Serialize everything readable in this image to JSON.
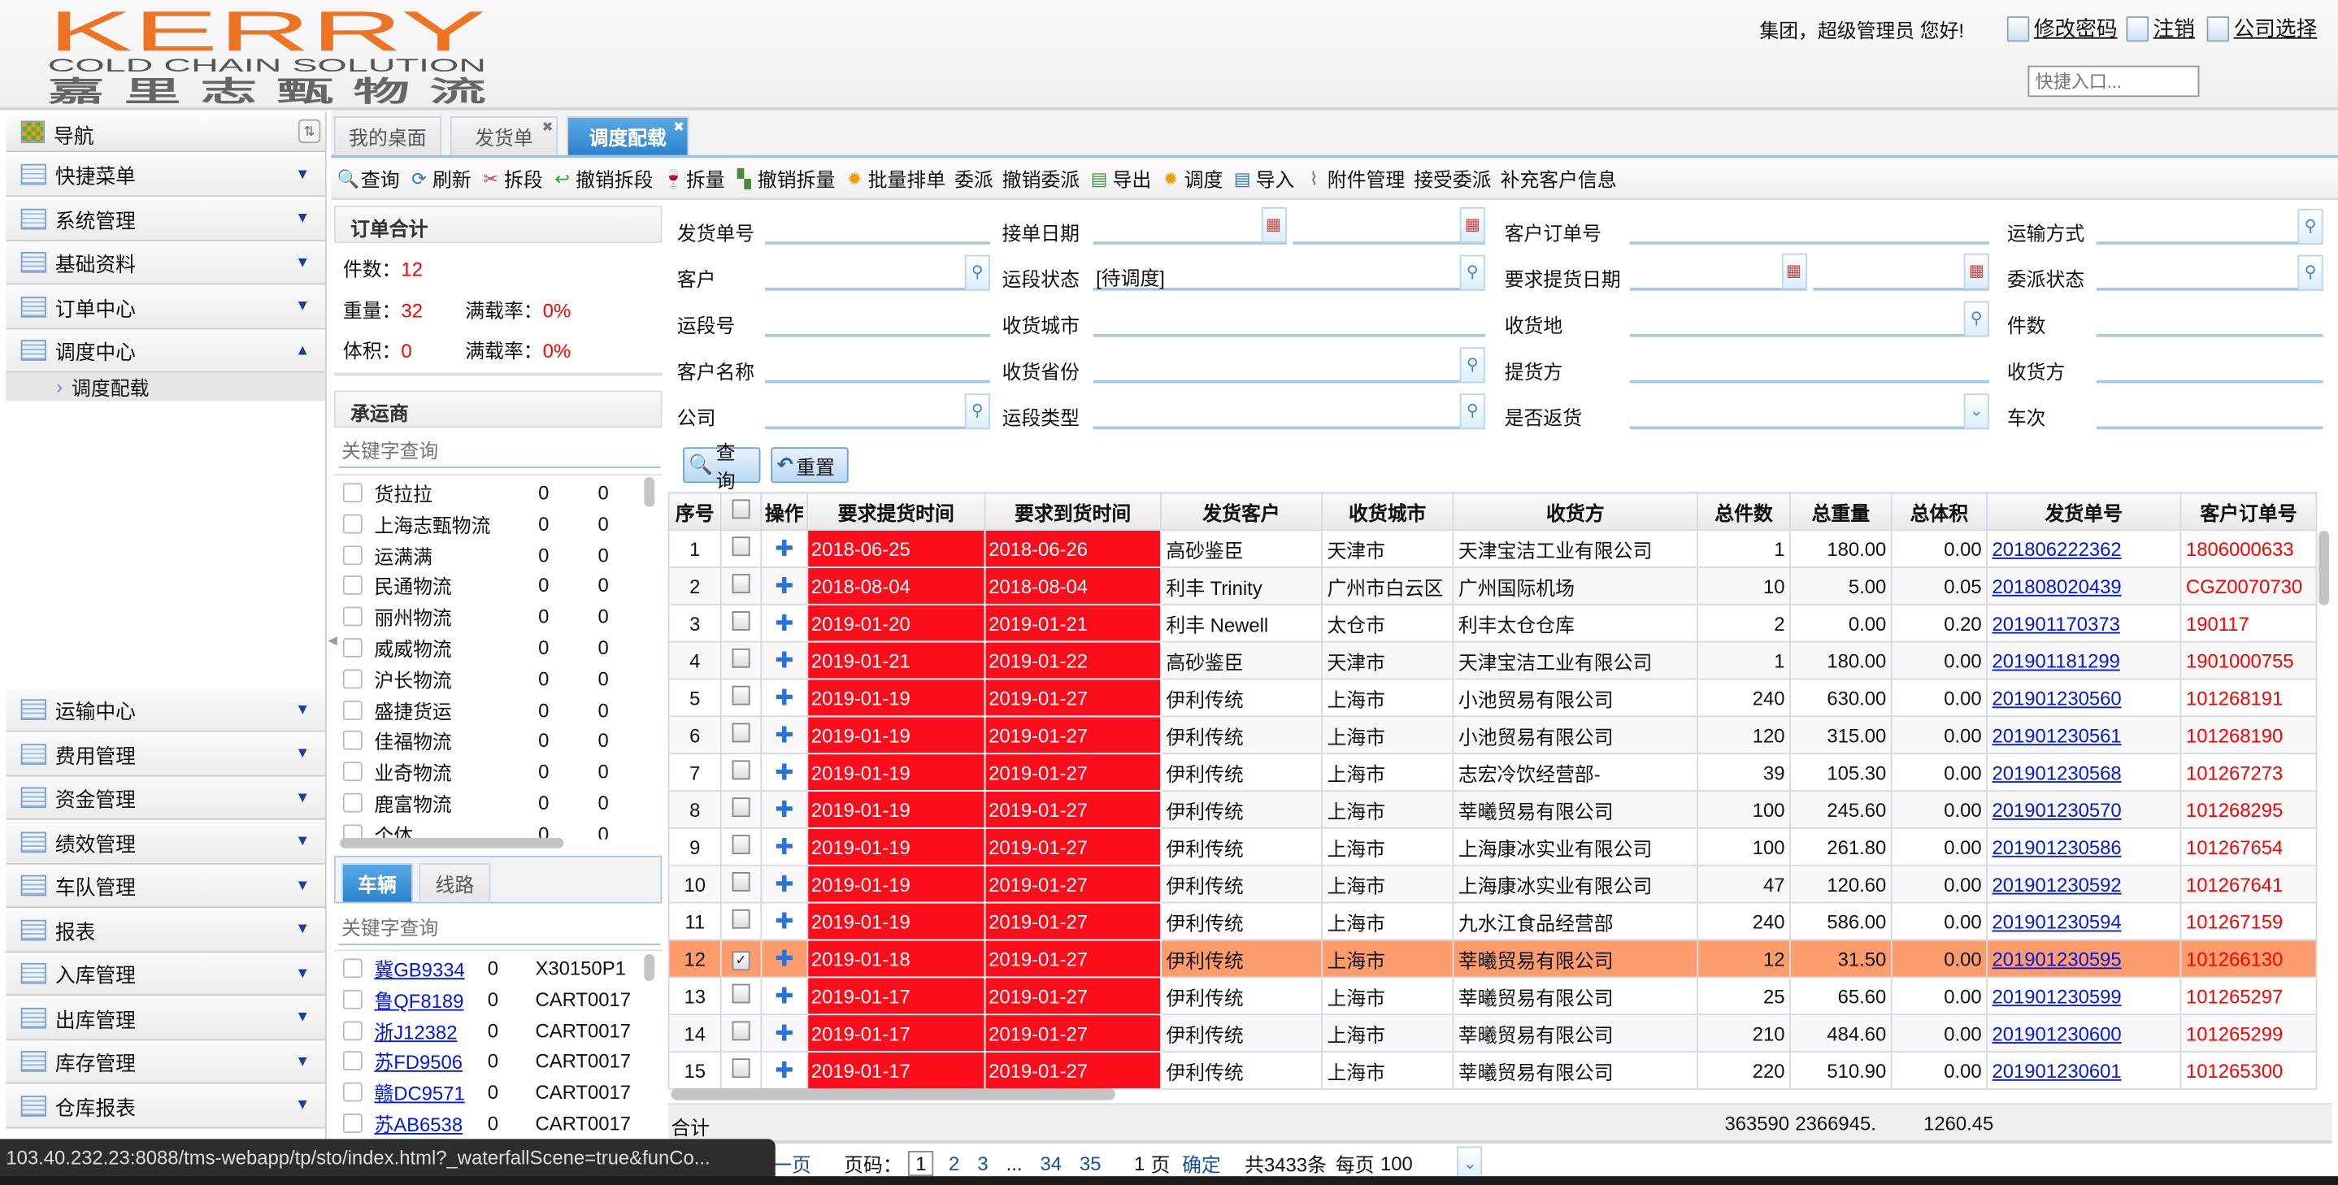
{
  "header": {
    "logo_text": "KERRY",
    "logo_sub": "COLD CHAIN SOLUTION",
    "logo_cn": "嘉 里 志 甄 物 流",
    "greeting": "集团，超级管理员 您好!",
    "links": [
      {
        "label": "修改密码",
        "icon": "edit-document-icon"
      },
      {
        "label": "注销",
        "icon": "logout-icon"
      },
      {
        "label": "公司选择",
        "icon": "company-select-icon"
      }
    ],
    "quick_entry_placeholder": "快捷入口..."
  },
  "sidebar": {
    "title": "导航",
    "items_top": [
      {
        "label": "快捷菜单",
        "state": "collapsed"
      },
      {
        "label": "系统管理",
        "state": "collapsed"
      },
      {
        "label": "基础资料",
        "state": "collapsed"
      },
      {
        "label": "订单中心",
        "state": "collapsed"
      },
      {
        "label": "调度中心",
        "state": "expanded"
      }
    ],
    "sub_item": "调度配载",
    "items_bottom": [
      {
        "label": "运输中心"
      },
      {
        "label": "费用管理"
      },
      {
        "label": "资金管理"
      },
      {
        "label": "绩效管理"
      },
      {
        "label": "车队管理"
      },
      {
        "label": "报表"
      },
      {
        "label": "入库管理"
      },
      {
        "label": "出库管理"
      },
      {
        "label": "库存管理"
      },
      {
        "label": "仓库报表"
      }
    ]
  },
  "tabs": [
    {
      "label": "我的桌面",
      "closable": false,
      "active": false
    },
    {
      "label": "发货单",
      "closable": true,
      "active": false
    },
    {
      "label": "调度配载",
      "closable": true,
      "active": true
    }
  ],
  "toolbar": [
    {
      "label": "查询",
      "icon": "search-icon"
    },
    {
      "label": "刷新",
      "icon": "refresh-icon"
    },
    {
      "label": "拆段",
      "icon": "split-segment-icon"
    },
    {
      "label": "撤销拆段",
      "icon": "undo-split-icon"
    },
    {
      "label": "拆量",
      "icon": "split-quantity-icon"
    },
    {
      "label": "撤销拆量",
      "icon": "undo-split-quantity-icon"
    },
    {
      "label": "批量排单",
      "icon": "gear-icon"
    },
    {
      "label": "委派",
      "icon": ""
    },
    {
      "label": "撤销委派",
      "icon": ""
    },
    {
      "label": "导出",
      "icon": "export-icon"
    },
    {
      "label": "调度",
      "icon": "gear-icon"
    },
    {
      "label": "导入",
      "icon": "import-icon"
    },
    {
      "label": "附件管理",
      "icon": "paperclip-icon"
    },
    {
      "label": "接受委派",
      "icon": ""
    },
    {
      "label": "补充客户信息",
      "icon": ""
    }
  ],
  "summary": {
    "title": "订单合计",
    "count_label": "件数：",
    "count": "12",
    "weight_label": "重量：",
    "weight": "32",
    "volume_label": "体积：",
    "volume": "0",
    "load_rate_label": "满载率：",
    "weight_rate": "0%",
    "volume_rate": "0%"
  },
  "carriers": {
    "title": "承运商",
    "search_placeholder": "关键字查询",
    "items": [
      {
        "name": "货拉拉",
        "a": "0",
        "b": "0"
      },
      {
        "name": "上海志甄物流",
        "a": "0",
        "b": "0"
      },
      {
        "name": "运满满",
        "a": "0",
        "b": "0"
      },
      {
        "name": "民通物流",
        "a": "0",
        "b": "0"
      },
      {
        "name": "丽州物流",
        "a": "0",
        "b": "0"
      },
      {
        "name": "威威物流",
        "a": "0",
        "b": "0"
      },
      {
        "name": "沪长物流",
        "a": "0",
        "b": "0"
      },
      {
        "name": "盛捷货运",
        "a": "0",
        "b": "0"
      },
      {
        "name": "佳福物流",
        "a": "0",
        "b": "0"
      },
      {
        "name": "业奇物流",
        "a": "0",
        "b": "0"
      },
      {
        "name": "鹿富物流",
        "a": "0",
        "b": "0"
      },
      {
        "name": "个体",
        "a": "0",
        "b": "0"
      }
    ]
  },
  "vehicles": {
    "tabs": [
      "车辆",
      "线路"
    ],
    "search_placeholder": "关键字查询",
    "items": [
      {
        "plate": "冀GB9334",
        "count": "0",
        "code": "X30150P1"
      },
      {
        "plate": "鲁QF8189",
        "count": "0",
        "code": "CART0017"
      },
      {
        "plate": "浙J12382",
        "count": "0",
        "code": "CART0017"
      },
      {
        "plate": "苏FD9506",
        "count": "0",
        "code": "CART0017"
      },
      {
        "plate": "赣DC9571",
        "count": "0",
        "code": "CART0017"
      },
      {
        "plate": "苏AB6538",
        "count": "0",
        "code": "CART0017"
      }
    ]
  },
  "form": {
    "fields": [
      {
        "label": "发货单号",
        "type": "text",
        "value": ""
      },
      {
        "label": "接单日期",
        "type": "daterange",
        "value": ""
      },
      {
        "label": "客户订单号",
        "type": "text",
        "value": ""
      },
      {
        "label": "运输方式",
        "type": "lookup",
        "value": ""
      },
      {
        "label": "客户",
        "type": "lookup",
        "value": ""
      },
      {
        "label": "运段状态",
        "type": "lookup",
        "value": "[待调度]"
      },
      {
        "label": "要求提货日期",
        "type": "daterange",
        "value": ""
      },
      {
        "label": "委派状态",
        "type": "lookup",
        "value": ""
      },
      {
        "label": "运段号",
        "type": "text",
        "value": ""
      },
      {
        "label": "收货城市",
        "type": "text",
        "value": ""
      },
      {
        "label": "收货地",
        "type": "lookup",
        "value": ""
      },
      {
        "label": "件数",
        "type": "text",
        "value": ""
      },
      {
        "label": "客户名称",
        "type": "text",
        "value": ""
      },
      {
        "label": "收货省份",
        "type": "lookup",
        "value": ""
      },
      {
        "label": "提货方",
        "type": "text",
        "value": ""
      },
      {
        "label": "收货方",
        "type": "text",
        "value": ""
      },
      {
        "label": "公司",
        "type": "lookup",
        "value": ""
      },
      {
        "label": "运段类型",
        "type": "lookup",
        "value": ""
      },
      {
        "label": "是否返货",
        "type": "select",
        "value": ""
      },
      {
        "label": "车次",
        "type": "text",
        "value": ""
      }
    ],
    "query_label": "查询",
    "reset_label": "重置"
  },
  "grid": {
    "columns": [
      "序号",
      "",
      "操作",
      "要求提货时间",
      "要求到货时间",
      "发货客户",
      "收货城市",
      "收货方",
      "总件数",
      "总重量",
      "总体积",
      "发货单号",
      "客户订单号"
    ],
    "rows": [
      {
        "no": "1",
        "checked": false,
        "pickup": "2018-06-25",
        "arrive": "2018-06-26",
        "shipper": "高砂鉴臣",
        "city": "天津市",
        "consignee": "天津宝洁工业有限公司",
        "qty": "1",
        "weight": "180.00",
        "volume": "0.00",
        "ship_no": "201806222362",
        "order_no": "1806000633"
      },
      {
        "no": "2",
        "checked": false,
        "pickup": "2018-08-04",
        "arrive": "2018-08-04",
        "shipper": "利丰 Trinity",
        "city": "广州市白云区",
        "consignee": "广州国际机场",
        "qty": "10",
        "weight": "5.00",
        "volume": "0.05",
        "ship_no": "201808020439",
        "order_no": "CGZ0070730"
      },
      {
        "no": "3",
        "checked": false,
        "pickup": "2019-01-20",
        "arrive": "2019-01-21",
        "shipper": "利丰 Newell",
        "city": "太仓市",
        "consignee": "利丰太仓仓库",
        "qty": "2",
        "weight": "0.00",
        "volume": "0.20",
        "ship_no": "201901170373",
        "order_no": "190117"
      },
      {
        "no": "4",
        "checked": false,
        "pickup": "2019-01-21",
        "arrive": "2019-01-22",
        "shipper": "高砂鉴臣",
        "city": "天津市",
        "consignee": "天津宝洁工业有限公司",
        "qty": "1",
        "weight": "180.00",
        "volume": "0.00",
        "ship_no": "201901181299",
        "order_no": "1901000755"
      },
      {
        "no": "5",
        "checked": false,
        "pickup": "2019-01-19",
        "arrive": "2019-01-27",
        "shipper": "伊利传统",
        "city": "上海市",
        "consignee": "小池贸易有限公司",
        "qty": "240",
        "weight": "630.00",
        "volume": "0.00",
        "ship_no": "201901230560",
        "order_no": "101268191"
      },
      {
        "no": "6",
        "checked": false,
        "pickup": "2019-01-19",
        "arrive": "2019-01-27",
        "shipper": "伊利传统",
        "city": "上海市",
        "consignee": "小池贸易有限公司",
        "qty": "120",
        "weight": "315.00",
        "volume": "0.00",
        "ship_no": "201901230561",
        "order_no": "101268190"
      },
      {
        "no": "7",
        "checked": false,
        "pickup": "2019-01-19",
        "arrive": "2019-01-27",
        "shipper": "伊利传统",
        "city": "上海市",
        "consignee": "志宏冷饮经营部-",
        "qty": "39",
        "weight": "105.30",
        "volume": "0.00",
        "ship_no": "201901230568",
        "order_no": "101267273"
      },
      {
        "no": "8",
        "checked": false,
        "pickup": "2019-01-19",
        "arrive": "2019-01-27",
        "shipper": "伊利传统",
        "city": "上海市",
        "consignee": "莘曦贸易有限公司",
        "qty": "100",
        "weight": "245.60",
        "volume": "0.00",
        "ship_no": "201901230570",
        "order_no": "101268295"
      },
      {
        "no": "9",
        "checked": false,
        "pickup": "2019-01-19",
        "arrive": "2019-01-27",
        "shipper": "伊利传统",
        "city": "上海市",
        "consignee": "上海康冰实业有限公司",
        "qty": "100",
        "weight": "261.80",
        "volume": "0.00",
        "ship_no": "201901230586",
        "order_no": "101267654"
      },
      {
        "no": "10",
        "checked": false,
        "pickup": "2019-01-19",
        "arrive": "2019-01-27",
        "shipper": "伊利传统",
        "city": "上海市",
        "consignee": "上海康冰实业有限公司",
        "qty": "47",
        "weight": "120.60",
        "volume": "0.00",
        "ship_no": "201901230592",
        "order_no": "101267641"
      },
      {
        "no": "11",
        "checked": false,
        "pickup": "2019-01-19",
        "arrive": "2019-01-27",
        "shipper": "伊利传统",
        "city": "上海市",
        "consignee": "九水江食品经营部",
        "qty": "240",
        "weight": "586.00",
        "volume": "0.00",
        "ship_no": "201901230594",
        "order_no": "101267159"
      },
      {
        "no": "12",
        "checked": true,
        "selected": true,
        "pickup": "2019-01-18",
        "arrive": "2019-01-27",
        "shipper": "伊利传统",
        "city": "上海市",
        "consignee": "莘曦贸易有限公司",
        "qty": "12",
        "weight": "31.50",
        "volume": "0.00",
        "ship_no": "201901230595",
        "order_no": "101266130"
      },
      {
        "no": "13",
        "checked": false,
        "pickup": "2019-01-17",
        "arrive": "2019-01-27",
        "shipper": "伊利传统",
        "city": "上海市",
        "consignee": "莘曦贸易有限公司",
        "qty": "25",
        "weight": "65.60",
        "volume": "0.00",
        "ship_no": "201901230599",
        "order_no": "101265297"
      },
      {
        "no": "14",
        "checked": false,
        "pickup": "2019-01-17",
        "arrive": "2019-01-27",
        "shipper": "伊利传统",
        "city": "上海市",
        "consignee": "莘曦贸易有限公司",
        "qty": "210",
        "weight": "484.60",
        "volume": "0.00",
        "ship_no": "201901230600",
        "order_no": "101265299"
      },
      {
        "no": "15",
        "checked": false,
        "pickup": "2019-01-17",
        "arrive": "2019-01-27",
        "shipper": "伊利传统",
        "city": "上海市",
        "consignee": "莘曦贸易有限公司",
        "qty": "220",
        "weight": "510.90",
        "volume": "0.00",
        "ship_no": "201901230601",
        "order_no": "101265300"
      }
    ],
    "totals": {
      "label": "合计",
      "qty": "363590",
      "weight": "2366945.",
      "volume": "1260.45"
    },
    "colors": {
      "overdue": "#fb0d1b",
      "selected_row": "#fd9c6c",
      "link": "#0018e0",
      "order_no": "#ff0000"
    }
  },
  "pager": {
    "prev": "一页",
    "page_label": "页码：",
    "current": "1",
    "pages": [
      "2",
      "3",
      "...",
      "34",
      "35"
    ],
    "goto_value": "1",
    "page_unit": "页",
    "confirm": "确定",
    "total": "共3433条",
    "per_page_label": "每页",
    "per_page": "100"
  },
  "statusbar": {
    "url": "103.40.232.23:8088/tms-webapp/tp/sto/index.html?_waterfallScene=true&funCo..."
  }
}
